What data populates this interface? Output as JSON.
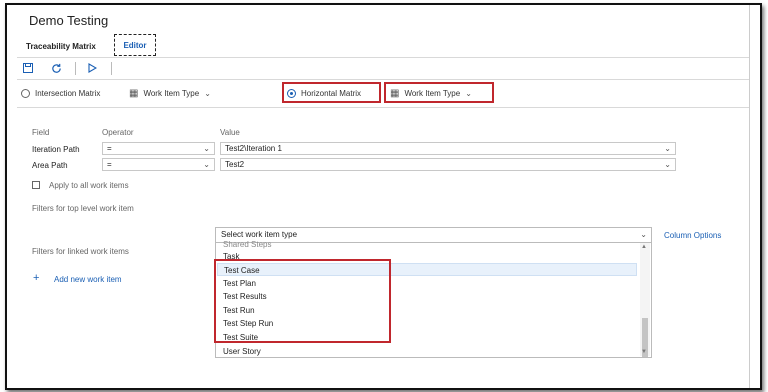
{
  "window": {
    "title": "Demo Testing"
  },
  "tabs": [
    {
      "label": "Traceability Matrix"
    },
    {
      "label": "Editor"
    }
  ],
  "toolbar": {
    "save_icon": "save-icon",
    "refresh_icon": "refresh-icon",
    "run_icon": "play-icon"
  },
  "matrix_options": {
    "intersection_label": "Intersection Matrix",
    "intersection_type": "Work Item Type",
    "horizontal_label": "Horizontal Matrix",
    "horizontal_type": "Work Item Type",
    "selected": "Horizontal Matrix"
  },
  "filters": {
    "headers": {
      "field": "Field",
      "operator": "Operator",
      "value": "Value"
    },
    "rows": [
      {
        "field": "Iteration Path",
        "operator": "=",
        "value": "Test2\\Iteration 1"
      },
      {
        "field": "Area Path",
        "operator": "=",
        "value": "Test2"
      }
    ],
    "apply_all_label": "Apply to all work items",
    "top_level_label": "Filters for top level work item",
    "linked_label": "Filters for linked work items",
    "add_new_label": "Add new work item",
    "column_options": "Column Options"
  },
  "work_item_dropdown": {
    "placeholder": "Select work item type",
    "partial_item": "Shared Steps",
    "items": [
      "Task",
      "Test Case",
      "Test Plan",
      "Test Results",
      "Test Run",
      "Test Step Run",
      "Test Suite",
      "User Story"
    ],
    "highlighted": "Test Case"
  },
  "colors": {
    "accent": "#1a5fb4",
    "highlight_box": "#c0272d"
  }
}
